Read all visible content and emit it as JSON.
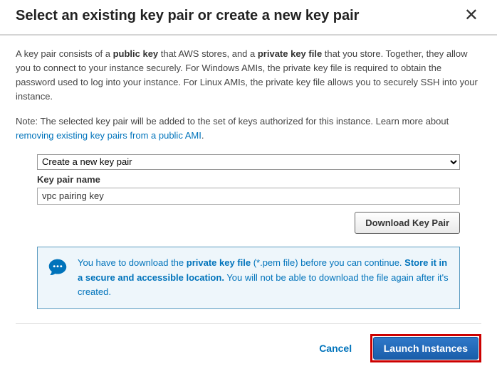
{
  "header": {
    "title": "Select an existing key pair or create a new key pair"
  },
  "body": {
    "desc_part1": "A key pair consists of a ",
    "desc_bold1": "public key",
    "desc_part2": " that AWS stores, and a ",
    "desc_bold2": "private key file",
    "desc_part3": " that you store. Together, they allow you to connect to your instance securely. For Windows AMIs, the private key file is required to obtain the password used to log into your instance. For Linux AMIs, the private key file allows you to securely SSH into your instance.",
    "note_part1": "Note: The selected key pair will be added to the set of keys authorized for this instance. Learn more about ",
    "note_link": "removing existing key pairs from a public AMI",
    "note_part2": "."
  },
  "form": {
    "select_value": "Create a new key pair",
    "keypair_label": "Key pair name",
    "keypair_value": "vpc pairing key",
    "download_label": "Download Key Pair"
  },
  "alert": {
    "part1": "You have to download the ",
    "bold1": "private key file",
    "part2": " (*.pem file) before you can continue. ",
    "bold2": "Store it in a secure and accessible location.",
    "part3": " You will not be able to download the file again after it's created."
  },
  "footer": {
    "cancel": "Cancel",
    "launch": "Launch Instances"
  }
}
